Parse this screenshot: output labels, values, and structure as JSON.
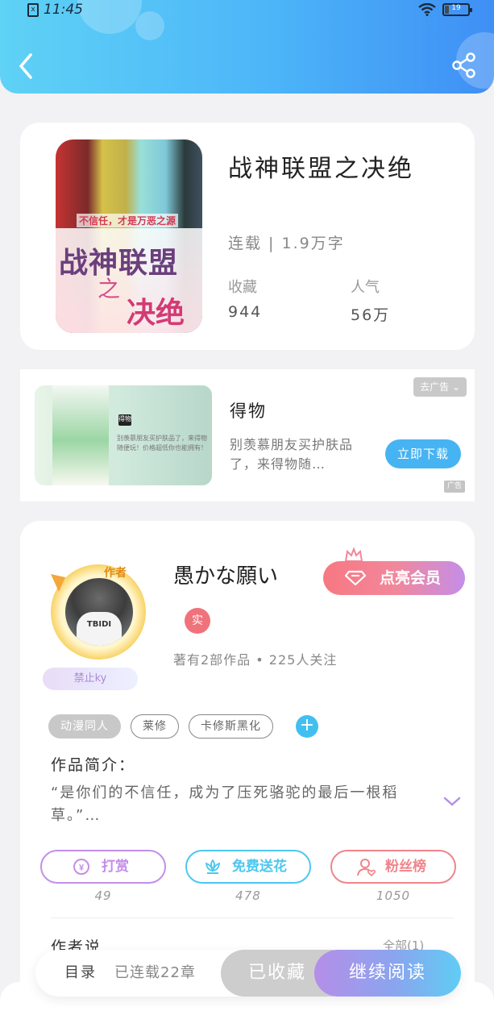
{
  "status_bar": {
    "time": "11:45",
    "sim_icon": "sim-card-icon",
    "battery_level": "19",
    "icons": [
      "wifi-icon",
      "battery-icon"
    ]
  },
  "header": {
    "back_icon": "back-arrow-icon",
    "share_icon": "share-icon",
    "gradient": [
      "#5fd2f6",
      "#3f8ff5"
    ]
  },
  "book": {
    "title": "战神联盟之决绝",
    "status": "连载 | 1.9万字",
    "cover": {
      "subtitle": "不信任，才是万恶之源",
      "title_line1": "战神联盟",
      "title_line2": "之",
      "title_line3": "决绝"
    },
    "stats": [
      {
        "label": "收藏",
        "value": "944"
      },
      {
        "label": "人气",
        "value": "56万"
      }
    ]
  },
  "ad": {
    "title": "得物",
    "description": "别羡慕朋友买护肤品了，来得物随…",
    "remove_label": "去广告",
    "download_label": "立即下载",
    "ad_tag": "广告",
    "image_logo": "得物",
    "image_text": "别羡慕朋友买护肤品了，来得物随便玩！价格超低你也能拥有！"
  },
  "author": {
    "badge": "作者",
    "name": "愚かな願い",
    "fan_tag": "禁止ky",
    "vip_label": "点亮会员",
    "real_badge": "实",
    "meta": "著有2部作品 • 225人关注",
    "avatar_text": "TBIDI",
    "tags": [
      "动漫同人",
      "莱修",
      "卡修斯黑化"
    ],
    "intro_label": "作品简介：",
    "intro_text": "“是你们的不信任，成为了压死骆驼的最后一根稻草。”…",
    "actions": [
      {
        "label": "打赏",
        "icon": "yen-icon",
        "count": "49",
        "color": "#c48ee8"
      },
      {
        "label": "免费送花",
        "icon": "flower-icon",
        "count": "478",
        "color": "#4cc7ef"
      },
      {
        "label": "粉丝榜",
        "icon": "fans-icon",
        "count": "1050",
        "color": "#f0848b"
      }
    ],
    "author_says": "作者说",
    "author_says_more": "全部(1)"
  },
  "bottom_bar": {
    "toc_label": "目录",
    "chapters": "已连载22章",
    "collected_label": "已收藏",
    "read_label": "继续阅读"
  }
}
